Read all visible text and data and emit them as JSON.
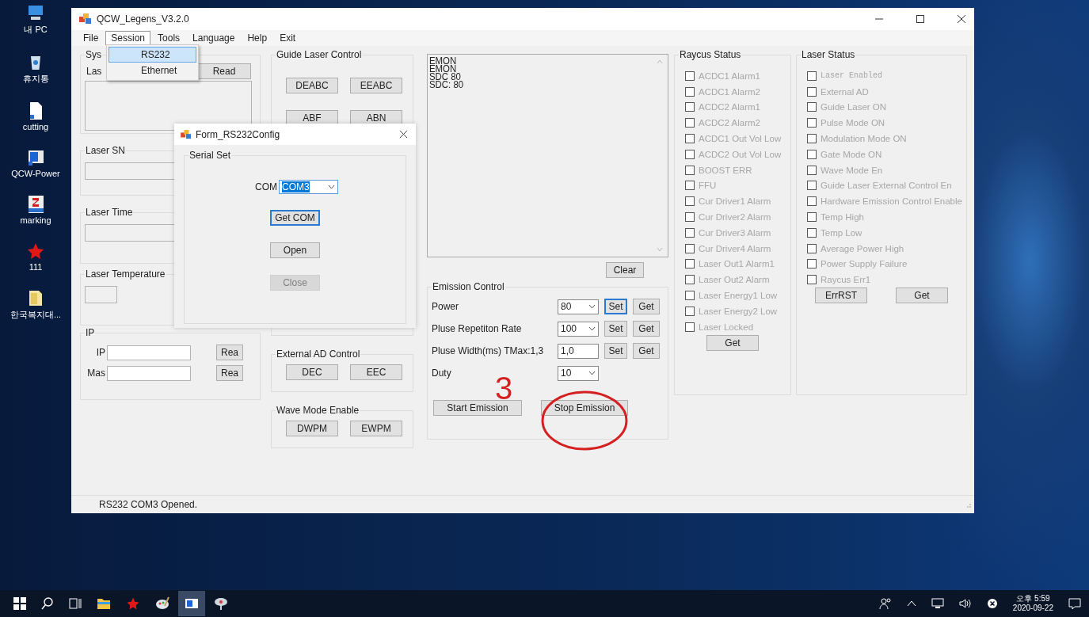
{
  "desktop_icons": [
    {
      "label": "내 PC",
      "kind": "computer"
    },
    {
      "label": "휴지통",
      "kind": "recycle"
    },
    {
      "label": "cutting",
      "kind": "document"
    },
    {
      "label": "QCW-Power",
      "kind": "app"
    },
    {
      "label": "marking",
      "kind": "cad"
    },
    {
      "label": "111",
      "kind": "star"
    },
    {
      "label": "한국복지대...",
      "kind": "folder"
    }
  ],
  "window": {
    "title": "QCW_Legens_V3.2.0"
  },
  "menu": [
    {
      "label": "File",
      "selected": false
    },
    {
      "label": "Session",
      "selected": true
    },
    {
      "label": "Tools",
      "selected": false
    },
    {
      "label": "Language",
      "selected": false
    },
    {
      "label": "Help",
      "selected": false
    },
    {
      "label": "Exit",
      "selected": false
    }
  ],
  "session_menu": [
    {
      "label": "RS232",
      "selected": true
    },
    {
      "label": "Ethernet",
      "selected": false
    }
  ],
  "system_group": {
    "title": "Sys",
    "label": "Las",
    "read_button": "Read"
  },
  "laser_sn": {
    "title": "Laser SN"
  },
  "laser_time": {
    "title": "Laser Time"
  },
  "laser_temperature": {
    "title": "Laser Temperature"
  },
  "ip_group": {
    "title": "IP",
    "fields": [
      {
        "label": "IP",
        "button": "Rea"
      },
      {
        "label": "Mas",
        "button": "Rea"
      }
    ]
  },
  "guide_laser_control": {
    "title": "Guide Laser Control",
    "buttons": [
      "DEABC",
      "EEABC",
      "ABF",
      "ABN"
    ]
  },
  "external_ad_control": {
    "title": "External AD Control",
    "buttons": [
      "DEC",
      "EEC"
    ]
  },
  "wave_mode_enable": {
    "title": "Wave Mode Enable",
    "buttons": [
      "DWPM",
      "EWPM"
    ]
  },
  "log": {
    "lines": [
      "EMON",
      "EMON",
      "SDC 80",
      "SDC: 80"
    ],
    "clear_button": "Clear"
  },
  "emission_control": {
    "title": "Emission Control",
    "rows": [
      {
        "label": "Power",
        "kind": "combo",
        "value": "80",
        "buttons": [
          {
            "label": "Set",
            "focused": true
          },
          {
            "label": "Get",
            "focused": false
          }
        ]
      },
      {
        "label": "Pluse Repetiton Rate",
        "kind": "combo",
        "value": "100",
        "buttons": [
          {
            "label": "Set",
            "focused": false
          },
          {
            "label": "Get",
            "focused": false
          }
        ]
      },
      {
        "label": "Pluse Width(ms) TMax:1,3",
        "kind": "text",
        "value": "1,0",
        "buttons": [
          {
            "label": "Set",
            "focused": false
          },
          {
            "label": "Get",
            "focused": false
          }
        ]
      },
      {
        "label": "Duty",
        "kind": "combo",
        "value": "10",
        "buttons": []
      }
    ],
    "start_button": "Start Emission",
    "stop_button": "Stop Emission"
  },
  "raycus_status": {
    "title": "Raycus Status",
    "items": [
      {
        "label": "ACDC1 Alarm1",
        "checked": false,
        "disabled": true
      },
      {
        "label": "ACDC1 Alarm2",
        "checked": false,
        "disabled": true
      },
      {
        "label": "ACDC2 Alarm1",
        "checked": false,
        "disabled": true
      },
      {
        "label": "ACDC2 Alarm2",
        "checked": false,
        "disabled": true
      },
      {
        "label": "ACDC1 Out Vol Low",
        "checked": false,
        "disabled": true
      },
      {
        "label": "ACDC2 Out Vol Low",
        "checked": false,
        "disabled": true
      },
      {
        "label": "BOOST ERR",
        "checked": false,
        "disabled": true
      },
      {
        "label": "FFU",
        "checked": false,
        "disabled": true
      },
      {
        "label": "Cur Driver1 Alarm",
        "checked": false,
        "disabled": true
      },
      {
        "label": "Cur Driver2 Alarm",
        "checked": false,
        "disabled": true
      },
      {
        "label": "Cur Driver3 Alarm",
        "checked": false,
        "disabled": true
      },
      {
        "label": "Cur Driver4 Alarm",
        "checked": false,
        "disabled": true
      },
      {
        "label": "Laser Out1 Alarm1",
        "checked": false,
        "disabled": true
      },
      {
        "label": "Laser Out2 Alarm",
        "checked": false,
        "disabled": true
      },
      {
        "label": "Laser Energy1 Low",
        "checked": false,
        "disabled": true
      },
      {
        "label": "Laser Energy2 Low",
        "checked": false,
        "disabled": true
      },
      {
        "label": "Laser Locked",
        "checked": false,
        "disabled": true
      }
    ],
    "get_button": "Get"
  },
  "laser_status": {
    "title": "Laser Status",
    "items": [
      {
        "label": "Laser Enabled",
        "kind": "custom",
        "checked": false,
        "disabled": true
      },
      {
        "label": "External AD",
        "kind": "standard",
        "checked": false,
        "disabled": true
      },
      {
        "label": "Guide Laser ON",
        "kind": "standard",
        "checked": false,
        "disabled": true
      },
      {
        "label": "Pulse Mode ON",
        "kind": "standard",
        "checked": false,
        "disabled": true
      },
      {
        "label": "Modulation Mode ON",
        "kind": "standard",
        "checked": false,
        "disabled": true
      },
      {
        "label": "Gate Mode ON",
        "kind": "standard",
        "checked": false,
        "disabled": true
      },
      {
        "label": "Wave Mode En",
        "kind": "standard",
        "checked": false,
        "disabled": true
      },
      {
        "label": "Guide Laser External Control En",
        "kind": "standard",
        "checked": false,
        "disabled": true
      },
      {
        "label": "Hardware Emission Control Enable",
        "kind": "standard",
        "checked": false,
        "disabled": true
      },
      {
        "label": "Temp High",
        "kind": "standard",
        "checked": false,
        "disabled": true
      },
      {
        "label": "Temp Low",
        "kind": "standard",
        "checked": false,
        "disabled": true
      },
      {
        "label": "Average Power High",
        "kind": "standard",
        "checked": false,
        "disabled": true
      },
      {
        "label": "Power Supply Failure",
        "kind": "standard",
        "checked": false,
        "disabled": true
      },
      {
        "label": "Raycus Err1",
        "kind": "standard",
        "checked": false,
        "disabled": true
      }
    ],
    "errrst_button": "ErrRST",
    "get_button": "Get"
  },
  "status_bar": {
    "text": "RS232 COM3 Opened."
  },
  "rs232_dialog": {
    "title": "Form_RS232Config",
    "group_title": "Serial Set",
    "com_label": "COM",
    "com_value": "COM3",
    "buttons": [
      {
        "label": "Get COM",
        "disabled": false,
        "focused": true
      },
      {
        "label": "Open",
        "disabled": false,
        "focused": false
      },
      {
        "label": "Close",
        "disabled": true,
        "focused": false
      }
    ]
  },
  "annotation": {
    "label": "3"
  },
  "taskbar": {
    "time": "오후 5:59",
    "date": "2020-09-22"
  }
}
